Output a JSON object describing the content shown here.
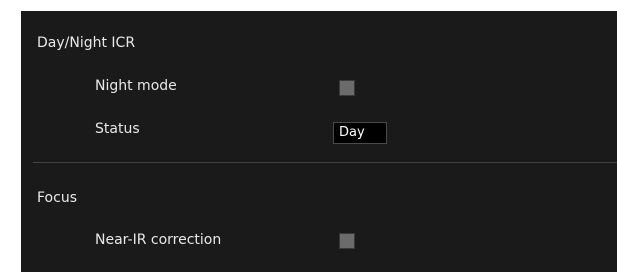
{
  "day_night": {
    "title": "Day/Night ICR",
    "night_mode": {
      "label": "Night mode",
      "checked": false
    },
    "status": {
      "label": "Status",
      "value": "Day"
    }
  },
  "focus": {
    "title": "Focus",
    "near_ir": {
      "label": "Near-IR correction",
      "checked": false
    }
  },
  "colors": {
    "panel_bg": "#1a1a1a",
    "text": "#e8e8e8",
    "checkbox": "#6b6b6b",
    "status_bg": "#000000"
  }
}
